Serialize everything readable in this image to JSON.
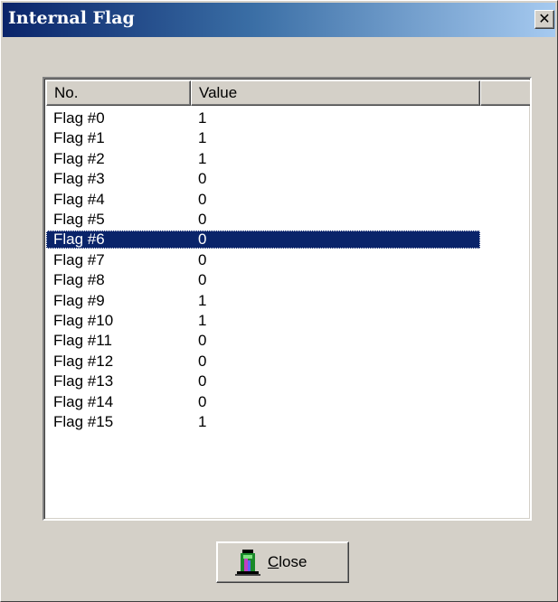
{
  "window": {
    "title": "Internal Flag",
    "close_glyph": "✕"
  },
  "list": {
    "columns": [
      "No.",
      "Value",
      ""
    ],
    "rows": [
      {
        "no": "Flag #0",
        "value": "1"
      },
      {
        "no": "Flag #1",
        "value": "1"
      },
      {
        "no": "Flag #2",
        "value": "1"
      },
      {
        "no": "Flag #3",
        "value": "0"
      },
      {
        "no": "Flag #4",
        "value": "0"
      },
      {
        "no": "Flag #5",
        "value": "0"
      },
      {
        "no": "Flag #6",
        "value": "0"
      },
      {
        "no": "Flag #7",
        "value": "0"
      },
      {
        "no": "Flag #8",
        "value": "0"
      },
      {
        "no": "Flag #9",
        "value": "1"
      },
      {
        "no": "Flag #10",
        "value": "1"
      },
      {
        "no": "Flag #11",
        "value": "0"
      },
      {
        "no": "Flag #12",
        "value": "0"
      },
      {
        "no": "Flag #13",
        "value": "0"
      },
      {
        "no": "Flag #14",
        "value": "0"
      },
      {
        "no": "Flag #15",
        "value": "1"
      }
    ],
    "selected_index": 6
  },
  "close_button": {
    "mnemonic": "C",
    "rest": "lose",
    "icon": "door-exit-icon"
  },
  "colors": {
    "selection": "#0a246a",
    "face": "#d4d0c8"
  }
}
